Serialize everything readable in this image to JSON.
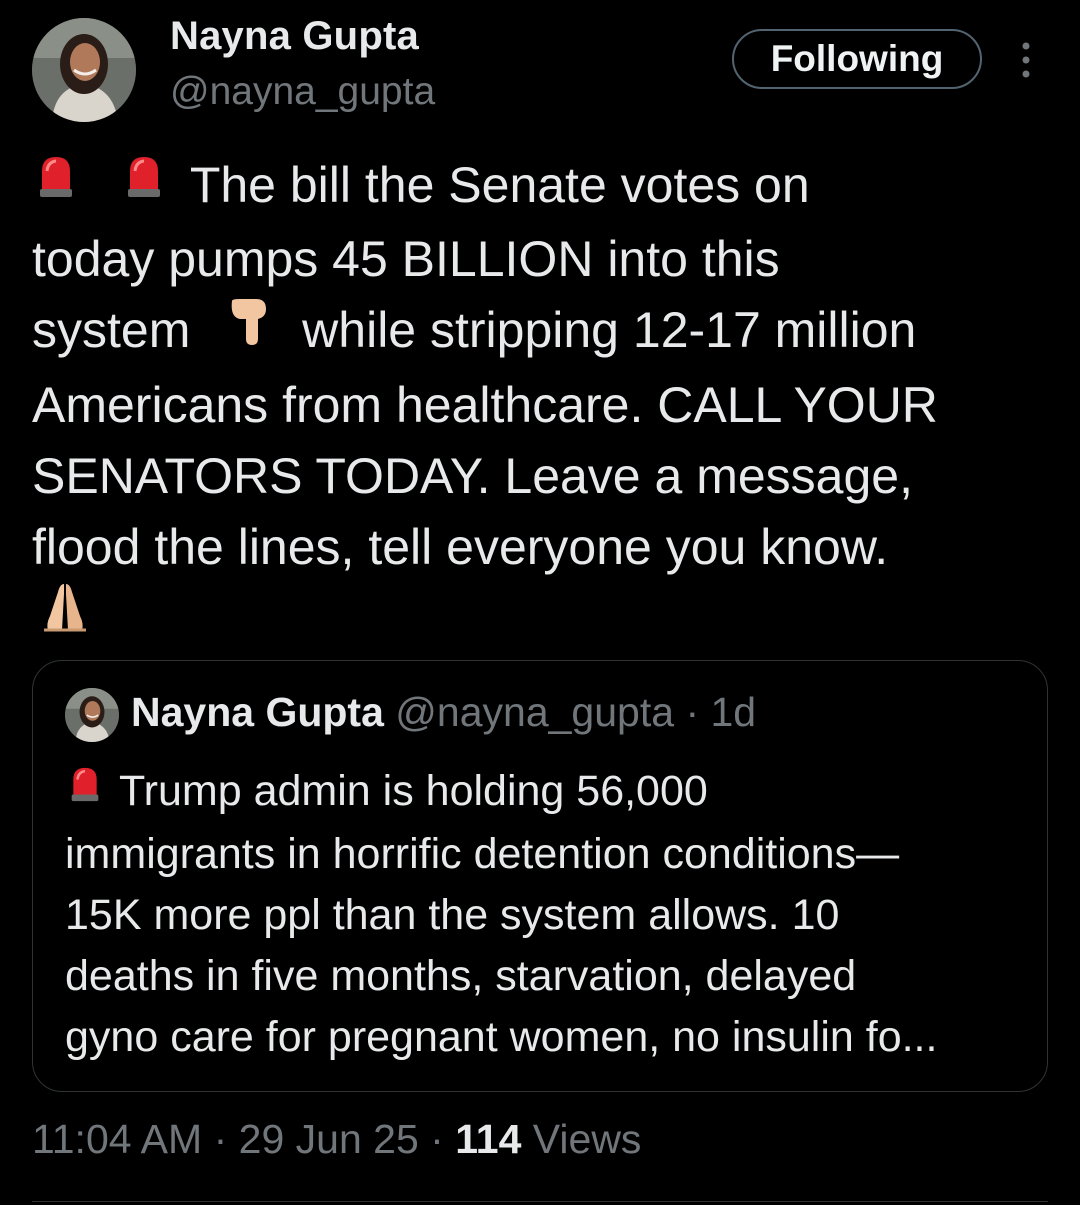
{
  "author": {
    "name": "Nayna Gupta",
    "handle": "@nayna_gupta",
    "avatar_icon": "profile-photo"
  },
  "follow_button": {
    "label": "Following"
  },
  "more_icon": "more-vertical-icon",
  "tweet": {
    "lines": [
      {
        "prefix_emoji": [
          "police-light",
          "police-light"
        ],
        "text": "The bill the Senate votes on"
      },
      {
        "text": "today pumps 45 BILLION into this"
      },
      {
        "text_before": "system",
        "emoji": "point-down-hand",
        "text_after": "while stripping 12-17 million"
      },
      {
        "text": "Americans from healthcare. CALL YOUR"
      },
      {
        "text": "SENATORS TODAY. Leave a message,"
      },
      {
        "text": "flood the lines, tell everyone you know."
      },
      {
        "emoji": "folded-hands"
      }
    ]
  },
  "quoted_tweet": {
    "name": "Nayna Gupta",
    "handle": "@nayna_gupta",
    "separator": "·",
    "time": "1d",
    "lines": [
      {
        "prefix_emoji": "police-light",
        "text": "Trump admin is holding 56,000"
      },
      {
        "text": "immigrants in horrific detention conditions—"
      },
      {
        "text": "15K more ppl than the system allows. 10"
      },
      {
        "text": "deaths in five months, starvation, delayed"
      },
      {
        "text": "gyno care for pregnant women, no insulin fo..."
      }
    ]
  },
  "meta": {
    "time": "11:04 AM",
    "sep1": "·",
    "date": "29 Jun 25",
    "sep2": "·",
    "views_count": "114",
    "views_label": "Views"
  },
  "colors": {
    "background": "#000000",
    "text": "#e7e9ea",
    "muted": "#71767b",
    "border": "#2f3336",
    "button_border": "#536471"
  }
}
